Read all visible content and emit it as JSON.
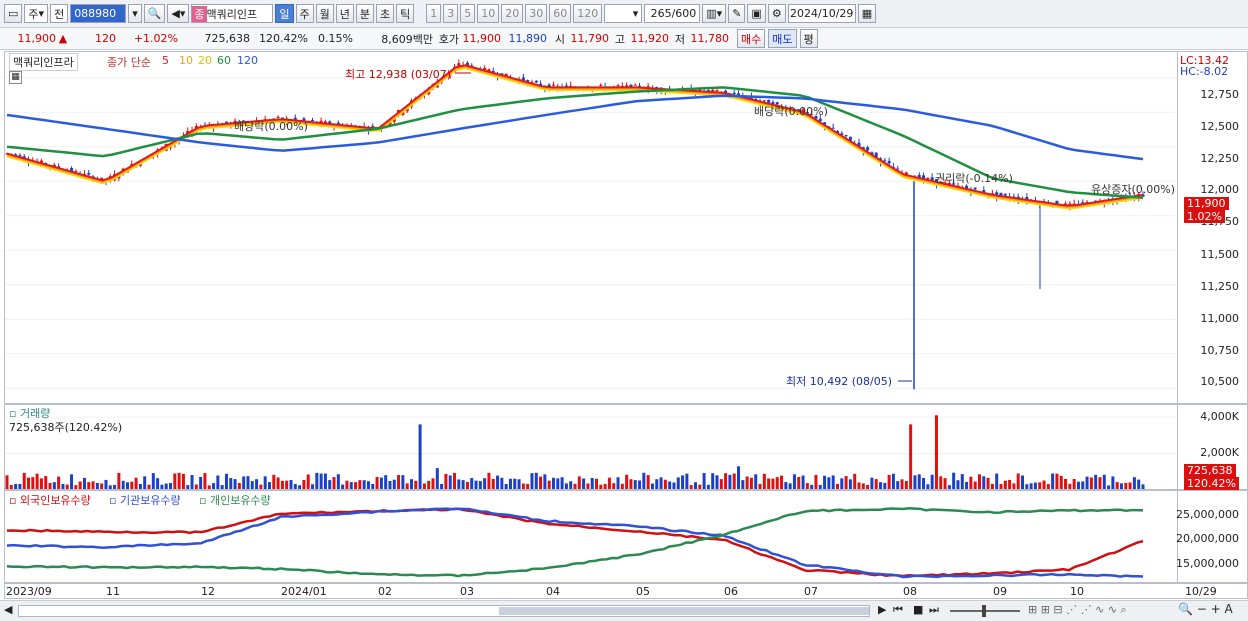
{
  "toolbar": {
    "market": "주",
    "mode": "전",
    "code": "088980",
    "name": "맥쿼리인프",
    "periods": [
      "일",
      "주",
      "월",
      "년",
      "분",
      "초",
      "틱"
    ],
    "active_period": "일",
    "intervals": [
      "1",
      "3",
      "5",
      "10",
      "20",
      "30",
      "60",
      "120"
    ],
    "count": "265",
    "count_total": "/600",
    "date": "2024/10/29"
  },
  "quote": {
    "price": "11,900",
    "arrow": "▲",
    "change": "120",
    "change_pct": "+1.02%",
    "volume": "725,638",
    "volume_pct": "120.42%",
    "turnover_pct": "0.15%",
    "amount": "8,609백만",
    "ask_label": "호가",
    "ask1": "11,900",
    "ask2": "11,890",
    "open_label": "시",
    "open": "11,790",
    "high_label": "고",
    "high": "11,920",
    "low_label": "저",
    "low": "11,780",
    "buy_label": "매수",
    "sell_label": "매도",
    "eval_label": "평"
  },
  "price_pane": {
    "title": "맥쿼리인프라",
    "ma_label": "종가 단순",
    "ma_periods": [
      "5",
      "10",
      "20",
      "60",
      "120"
    ],
    "ma_colors": {
      "5": "#e01b1b",
      "10": "#f0a020",
      "20": "#f5e000",
      "60": "#209040",
      "120": "#2a5ae0"
    },
    "high_note": "최고 12,938 (03/07)",
    "low_note": "최저 10,492 (08/05)",
    "events": [
      "배당락(0.00%)",
      "배당락(0.00%)",
      "권리락(-0.14%)",
      "유상증자(0.00%)"
    ],
    "lc": "LC:13.42",
    "hc": "HC:-8.02",
    "price_tag": "11,900",
    "pct_tag": "1.02%",
    "y_ticks": [
      "12,750",
      "12,500",
      "12,250",
      "12,000",
      "11,750",
      "11,500",
      "11,250",
      "11,000",
      "10,750",
      "10,500"
    ]
  },
  "volume_pane": {
    "title": "거래량",
    "value": "725,638주(120.42%)",
    "y_ticks": [
      "4,000K",
      "2,000K"
    ],
    "tag": "725,638",
    "tag_pct": "120.42%"
  },
  "holder_pane": {
    "legend": [
      "외국인보유수량",
      "기관보유수량",
      "개인보유수량"
    ],
    "colors": [
      "#d01010",
      "#3050d8",
      "#2a8a50"
    ],
    "y_ticks": [
      "25,000,000",
      "20,000,000",
      "15,000,000"
    ]
  },
  "x_axis": {
    "labels": [
      "2023/09",
      "11",
      "12",
      "2024/01",
      "02",
      "03",
      "04",
      "05",
      "06",
      "07",
      "08",
      "09",
      "10"
    ],
    "last": "10/29"
  },
  "chart_data": [
    {
      "type": "line",
      "title": "맥쿼리인프라",
      "x": [
        "2023/09",
        "11",
        "12",
        "2024/01",
        "02",
        "03",
        "04",
        "05",
        "06",
        "07",
        "08",
        "09",
        "10",
        "10/29"
      ],
      "series": [
        {
          "name": "5",
          "values": [
            12200,
            12000,
            12400,
            12450,
            12380,
            12850,
            12680,
            12680,
            12640,
            12500,
            12050,
            11900,
            11820,
            11900
          ]
        },
        {
          "name": "60",
          "values": [
            12250,
            12180,
            12350,
            12300,
            12380,
            12520,
            12600,
            12650,
            12680,
            12620,
            12330,
            12020,
            11920,
            11880
          ]
        },
        {
          "name": "120",
          "values": [
            12480,
            12380,
            12280,
            12220,
            12280,
            12380,
            12480,
            12580,
            12620,
            12600,
            12520,
            12400,
            12230,
            12160
          ]
        }
      ],
      "ylim": [
        10400,
        12900
      ],
      "annotations": [
        "최고 12,938 (03/07)",
        "최저 10,492 (08/05)"
      ]
    },
    {
      "type": "bar",
      "title": "거래량",
      "categories": [
        "2023/09",
        "11",
        "12",
        "2024/01",
        "02",
        "03",
        "04",
        "05",
        "06",
        "07",
        "08",
        "09",
        "10",
        "10/29"
      ],
      "values": [
        400,
        350,
        500,
        3600,
        650,
        900,
        700,
        600,
        1000,
        3600,
        4100,
        1300,
        1000,
        725.6
      ],
      "ylim": [
        0,
        4500
      ]
    },
    {
      "type": "line",
      "x": [
        "2023/09",
        "11",
        "12",
        "2024/01",
        "02",
        "03",
        "04",
        "05",
        "06",
        "07",
        "08",
        "09",
        "10",
        "10/29"
      ],
      "series": [
        {
          "name": "외국인보유수량",
          "values": [
            22800,
            22500,
            22400,
            25800,
            26300,
            26600,
            24000,
            22600,
            21000,
            15500,
            14400,
            14900,
            15600,
            20800
          ]
        },
        {
          "name": "기관보유수량",
          "values": [
            20000,
            19700,
            20400,
            25200,
            26200,
            26800,
            24500,
            23500,
            21800,
            16500,
            14300,
            14500,
            14700,
            14300
          ]
        },
        {
          "name": "개인보유수량",
          "values": [
            16200,
            16000,
            16100,
            15700,
            14700,
            14500,
            15800,
            18300,
            22000,
            26300,
            26700,
            26100,
            26400,
            26500
          ]
        }
      ],
      "ylim": [
        13500,
        28500
      ]
    }
  ]
}
